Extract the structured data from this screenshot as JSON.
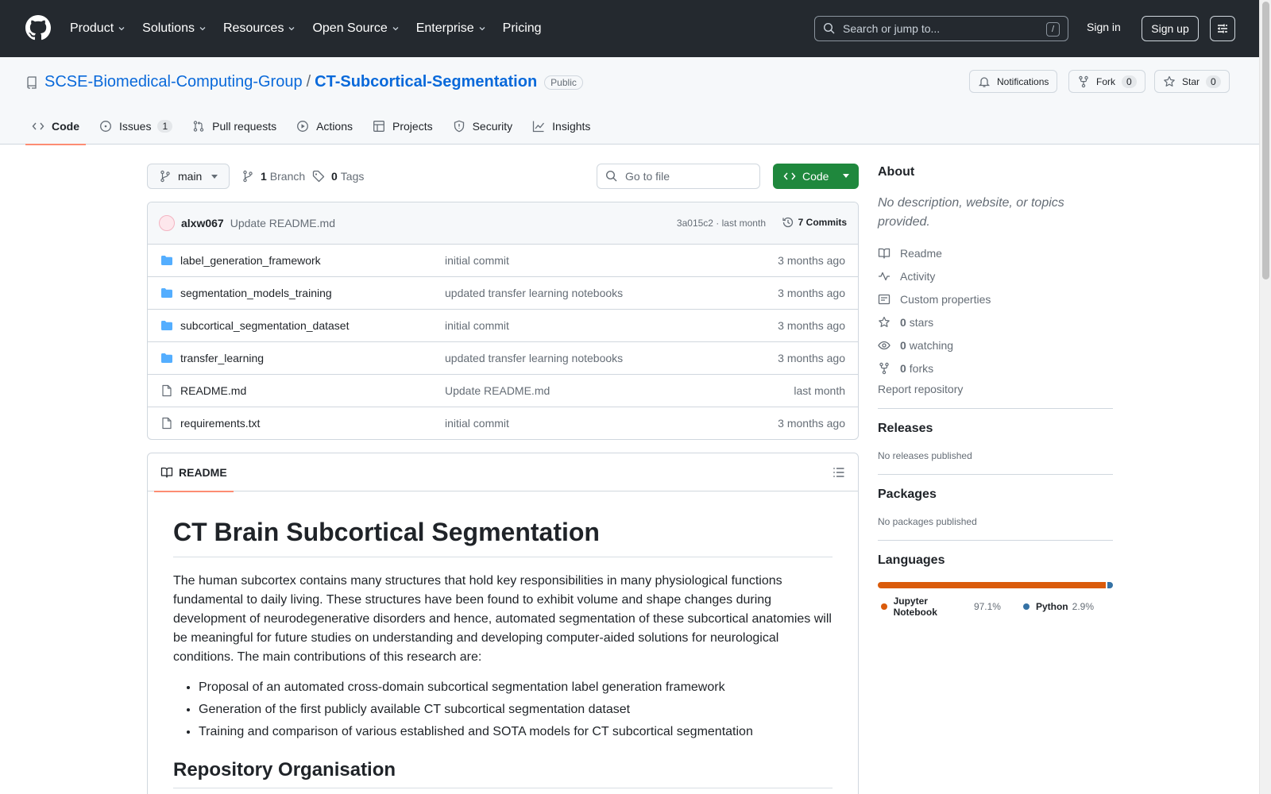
{
  "header": {
    "nav": [
      "Product",
      "Solutions",
      "Resources",
      "Open Source",
      "Enterprise",
      "Pricing"
    ],
    "search_placeholder": "Search or jump to...",
    "search_shortcut": "/",
    "sign_in": "Sign in",
    "sign_up": "Sign up"
  },
  "repo": {
    "owner": "SCSE-Biomedical-Computing-Group",
    "separator": "/",
    "name": "CT-Subcortical-Segmentation",
    "visibility": "Public",
    "notifications_label": "Notifications",
    "fork_label": "Fork",
    "fork_count": "0",
    "star_label": "Star",
    "star_count": "0"
  },
  "tabs": [
    {
      "label": "Code",
      "icon": "code-icon"
    },
    {
      "label": "Issues",
      "icon": "issue-icon",
      "count": "1"
    },
    {
      "label": "Pull requests",
      "icon": "pull-request-icon"
    },
    {
      "label": "Actions",
      "icon": "play-icon"
    },
    {
      "label": "Projects",
      "icon": "table-icon"
    },
    {
      "label": "Security",
      "icon": "shield-icon"
    },
    {
      "label": "Insights",
      "icon": "graph-icon"
    }
  ],
  "toolbar": {
    "branch": "main",
    "branch_count": "1",
    "branch_label": "Branch",
    "tag_count": "0",
    "tag_label": "Tags",
    "goto_placeholder": "Go to file",
    "code_button": "Code"
  },
  "commit": {
    "author": "alxw067",
    "message": "Update README.md",
    "hash_time": "3a015c2 · last month",
    "commits": "7 Commits"
  },
  "files": [
    {
      "type": "folder",
      "name": "label_generation_framework",
      "message": "initial commit",
      "time": "3 months ago"
    },
    {
      "type": "folder",
      "name": "segmentation_models_training",
      "message": "updated transfer learning notebooks",
      "time": "3 months ago"
    },
    {
      "type": "folder",
      "name": "subcortical_segmentation_dataset",
      "message": "initial commit",
      "time": "3 months ago"
    },
    {
      "type": "folder",
      "name": "transfer_learning",
      "message": "updated transfer learning notebooks",
      "time": "3 months ago"
    },
    {
      "type": "file",
      "name": "README.md",
      "message": "Update README.md",
      "time": "last month"
    },
    {
      "type": "file",
      "name": "requirements.txt",
      "message": "initial commit",
      "time": "3 months ago"
    }
  ],
  "readme": {
    "tab_label": "README",
    "title": "CT Brain Subcortical Segmentation",
    "paragraph": "The human subcortex contains many structures that hold key responsibilities in many physiological functions fundamental to daily living. These structures have been found to exhibit volume and shape changes during development of neurodegenerative disorders and hence, automated segmentation of these subcortical anatomies will be meaningful for future studies on understanding and developing computer-aided solutions for neurological conditions. The main contributions of this research are:",
    "bullets": [
      "Proposal of an automated cross-domain subcortical segmentation label generation framework",
      "Generation of the first publicly available CT subcortical segmentation dataset",
      "Training and comparison of various established and SOTA models for CT subcortical segmentation"
    ],
    "section2": "Repository Organisation"
  },
  "sidebar": {
    "about_title": "About",
    "about_desc": "No description, website, or topics provided.",
    "items": [
      {
        "icon": "book-icon",
        "label": "Readme"
      },
      {
        "icon": "pulse-icon",
        "label": "Activity"
      },
      {
        "icon": "note-icon",
        "label": "Custom properties"
      },
      {
        "icon": "star-icon",
        "count": "0",
        "label": "stars"
      },
      {
        "icon": "eye-icon",
        "count": "0",
        "label": "watching"
      },
      {
        "icon": "fork-icon",
        "count": "0",
        "label": "forks"
      }
    ],
    "report": "Report repository",
    "releases_title": "Releases",
    "releases_text": "No releases published",
    "packages_title": "Packages",
    "packages_text": "No packages published",
    "languages_title": "Languages",
    "languages": [
      {
        "name": "Jupyter Notebook",
        "percent": "97.1%",
        "value": 97.1,
        "color": "#DA5B0B"
      },
      {
        "name": "Python",
        "percent": "2.9%",
        "value": 2.9,
        "color": "#3572A5"
      }
    ]
  },
  "colors": {
    "header_bg": "#24292f",
    "link": "#0969da",
    "code_button": "#1f883d",
    "tab_underline": "#fd8c73",
    "folder": "#54aeff"
  }
}
